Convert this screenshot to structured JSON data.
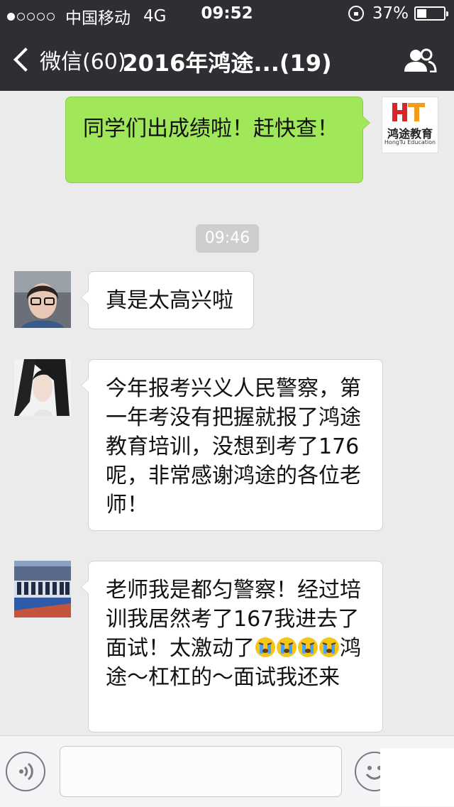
{
  "status_bar": {
    "signal_dots_filled": 1,
    "signal_dots_total": 5,
    "carrier": "中国移动",
    "network": "4G",
    "time": "09:52",
    "battery_percent_text": "37%",
    "battery_level": 0.37
  },
  "nav": {
    "back_label": "微信(60)",
    "title": "2016年鸿途...(19)",
    "contacts_icon": "group-icon"
  },
  "messages": [
    {
      "side": "right",
      "text": "同学们出成绩啦！赶快查！",
      "avatar": {
        "logo_mark": "HT",
        "logo_name": "鸿途教育",
        "logo_sub": "HongTu Education"
      }
    },
    {
      "side": "left",
      "text": "真是太高兴啦"
    },
    {
      "side": "left",
      "text": "今年报考兴义人民警察，第一年考没有把握就报了鸿途教育培训，没想到考了176呢，非常感谢鸿途的各位老师！"
    },
    {
      "side": "left",
      "text_part1": "老师我是都匀警察！经过培训我居然考了167我进去了面试！太激动了",
      "text_part2": "鸿途～杠杠的～面试我还来",
      "emoji_name": "crying-face-emoji"
    }
  ],
  "timestamp": "09:46",
  "colors": {
    "nav_bg": "#2e2e33",
    "chat_bg": "#ebebeb",
    "sent_bubble": "#a0e75a",
    "received_bubble": "#ffffff",
    "logo_red": "#d8252a",
    "logo_orange": "#f29b1f"
  },
  "input_bar": {
    "voice_icon": "voice-icon",
    "emoji_icon": "smiley-icon",
    "text_value": ""
  }
}
